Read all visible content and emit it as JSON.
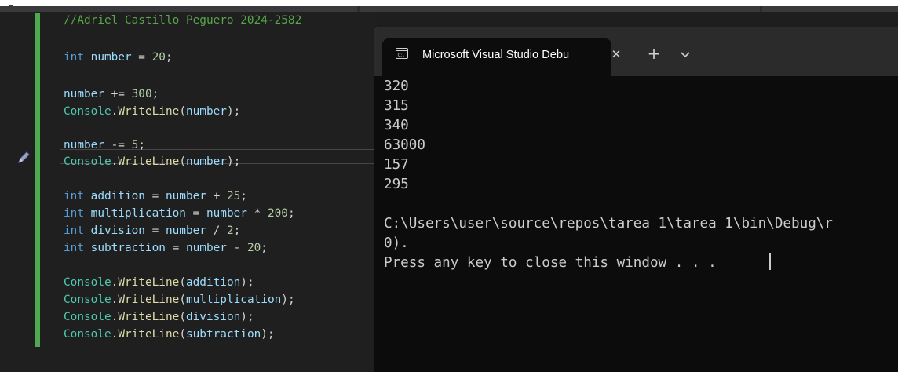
{
  "editor": {
    "lines": [
      {
        "tokens": [
          {
            "t": "//Adriel Castillo Peguero 2024-2582",
            "c": "cmt"
          }
        ]
      },
      {
        "tokens": [
          {
            "t": "int ",
            "c": "kw"
          },
          {
            "t": "number",
            "c": "var"
          },
          {
            "t": " = ",
            "c": "op"
          },
          {
            "t": "20",
            "c": "num"
          },
          {
            "t": ";",
            "c": "op"
          }
        ]
      },
      {
        "tokens": [
          {
            "t": "number",
            "c": "var"
          },
          {
            "t": " += ",
            "c": "op"
          },
          {
            "t": "300",
            "c": "num"
          },
          {
            "t": ";",
            "c": "op"
          }
        ]
      },
      {
        "tokens": [
          {
            "t": "Console",
            "c": "cls"
          },
          {
            "t": ".",
            "c": "op"
          },
          {
            "t": "WriteLine",
            "c": "fn"
          },
          {
            "t": "(",
            "c": "op"
          },
          {
            "t": "number",
            "c": "var"
          },
          {
            "t": ");",
            "c": "op"
          }
        ]
      },
      {
        "tokens": [
          {
            "t": "number",
            "c": "var"
          },
          {
            "t": " -= ",
            "c": "op"
          },
          {
            "t": "5",
            "c": "num"
          },
          {
            "t": ";",
            "c": "op"
          }
        ]
      },
      {
        "tokens": [
          {
            "t": "Console",
            "c": "cls"
          },
          {
            "t": ".",
            "c": "op"
          },
          {
            "t": "WriteLine",
            "c": "fn"
          },
          {
            "t": "(",
            "c": "op"
          },
          {
            "t": "number",
            "c": "var"
          },
          {
            "t": ");",
            "c": "op"
          }
        ]
      },
      {
        "tokens": [
          {
            "t": "int ",
            "c": "kw"
          },
          {
            "t": "addition",
            "c": "var"
          },
          {
            "t": " = ",
            "c": "op"
          },
          {
            "t": "number",
            "c": "var"
          },
          {
            "t": " + ",
            "c": "op"
          },
          {
            "t": "25",
            "c": "num"
          },
          {
            "t": ";",
            "c": "op"
          }
        ]
      },
      {
        "tokens": [
          {
            "t": "int ",
            "c": "kw"
          },
          {
            "t": "multiplication",
            "c": "var"
          },
          {
            "t": " = ",
            "c": "op"
          },
          {
            "t": "number",
            "c": "var"
          },
          {
            "t": " * ",
            "c": "op"
          },
          {
            "t": "200",
            "c": "num"
          },
          {
            "t": ";",
            "c": "op"
          }
        ]
      },
      {
        "tokens": [
          {
            "t": "int ",
            "c": "kw"
          },
          {
            "t": "division",
            "c": "var"
          },
          {
            "t": " = ",
            "c": "op"
          },
          {
            "t": "number",
            "c": "var"
          },
          {
            "t": " / ",
            "c": "op"
          },
          {
            "t": "2",
            "c": "num"
          },
          {
            "t": ";",
            "c": "op"
          }
        ]
      },
      {
        "tokens": [
          {
            "t": "int ",
            "c": "kw"
          },
          {
            "t": "subtraction",
            "c": "var"
          },
          {
            "t": " = ",
            "c": "op"
          },
          {
            "t": "number",
            "c": "var"
          },
          {
            "t": " - ",
            "c": "op"
          },
          {
            "t": "20",
            "c": "num"
          },
          {
            "t": ";",
            "c": "op"
          }
        ]
      },
      {
        "tokens": [
          {
            "t": "Console",
            "c": "cls"
          },
          {
            "t": ".",
            "c": "op"
          },
          {
            "t": "WriteLine",
            "c": "fn"
          },
          {
            "t": "(",
            "c": "op"
          },
          {
            "t": "addition",
            "c": "var"
          },
          {
            "t": ");",
            "c": "op"
          }
        ]
      },
      {
        "tokens": [
          {
            "t": "Console",
            "c": "cls"
          },
          {
            "t": ".",
            "c": "op"
          },
          {
            "t": "WriteLine",
            "c": "fn"
          },
          {
            "t": "(",
            "c": "op"
          },
          {
            "t": "multiplication",
            "c": "var"
          },
          {
            "t": ");",
            "c": "op"
          }
        ]
      },
      {
        "tokens": [
          {
            "t": "Console",
            "c": "cls"
          },
          {
            "t": ".",
            "c": "op"
          },
          {
            "t": "WriteLine",
            "c": "fn"
          },
          {
            "t": "(",
            "c": "op"
          },
          {
            "t": "division",
            "c": "var"
          },
          {
            "t": ");",
            "c": "op"
          }
        ]
      },
      {
        "tokens": [
          {
            "t": "Console",
            "c": "cls"
          },
          {
            "t": ".",
            "c": "op"
          },
          {
            "t": "WriteLine",
            "c": "fn"
          },
          {
            "t": "(",
            "c": "op"
          },
          {
            "t": "subtraction",
            "c": "var"
          },
          {
            "t": ");",
            "c": "op"
          }
        ]
      }
    ]
  },
  "console": {
    "tab_title": "Microsoft Visual Studio Debu",
    "tab_icon": "console-app-icon",
    "close_glyph": "✕",
    "new_tab_glyph": "+",
    "dropdown_icon": "chevron-down-icon",
    "output_lines": [
      "320",
      "315",
      "340",
      "63000",
      "157",
      "295",
      "",
      "C:\\Users\\user\\source\\repos\\tarea 1\\tarea 1\\bin\\Debug\\r",
      "0).",
      "Press any key to close this window . . ."
    ]
  },
  "colors": {
    "editor_background": "#1f1f1f",
    "gutter_change_bar": "#4ea94f",
    "console_background": "#0c0c0c",
    "titlebar": "#2b2b2b",
    "comment": "#57a64a",
    "keyword": "#569cd6",
    "variable": "#9cdcfe",
    "number": "#b5cea8",
    "class": "#4ec9b0",
    "method": "#dcdcaa"
  }
}
